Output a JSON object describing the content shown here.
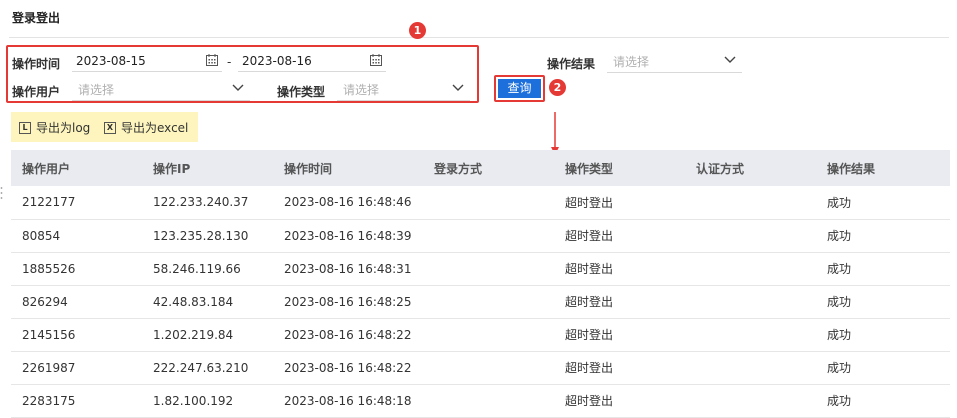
{
  "page": {
    "title": "登录登出"
  },
  "filters": {
    "operation_time_label": "操作时间",
    "date_start": "2023-08-15",
    "date_separator": "-",
    "date_end": "2023-08-16",
    "operation_user_label": "操作用户",
    "operation_user_placeholder": "请选择",
    "operation_type_label": "操作类型",
    "operation_type_placeholder": "请选择",
    "operation_result_label": "操作结果",
    "operation_result_placeholder": "请选择",
    "query_label": "查询"
  },
  "annotations": {
    "badge_1": "1",
    "badge_2": "2",
    "accent_color": "#e53935"
  },
  "export": {
    "log_label": "导出为log",
    "excel_label": "导出为excel",
    "log_icon_letter": "L",
    "excel_icon_letter": "X"
  },
  "table": {
    "columns": [
      "操作用户",
      "操作IP",
      "操作时间",
      "登录方式",
      "操作类型",
      "认证方式",
      "操作结果"
    ],
    "rows": [
      [
        "2122177",
        "122.233.240.37",
        "2023-08-16 16:48:46",
        "",
        "超时登出",
        "",
        "成功"
      ],
      [
        "80854",
        "123.235.28.130",
        "2023-08-16 16:48:39",
        "",
        "超时登出",
        "",
        "成功"
      ],
      [
        "1885526",
        "58.246.119.66",
        "2023-08-16 16:48:31",
        "",
        "超时登出",
        "",
        "成功"
      ],
      [
        "826294",
        "42.48.83.184",
        "2023-08-16 16:48:25",
        "",
        "超时登出",
        "",
        "成功"
      ],
      [
        "2145156",
        "1.202.219.84",
        "2023-08-16 16:48:22",
        "",
        "超时登出",
        "",
        "成功"
      ],
      [
        "2261987",
        "222.247.63.210",
        "2023-08-16 16:48:22",
        "",
        "超时登出",
        "",
        "成功"
      ],
      [
        "2283175",
        "1.82.100.192",
        "2023-08-16 16:48:18",
        "",
        "超时登出",
        "",
        "成功"
      ]
    ]
  }
}
